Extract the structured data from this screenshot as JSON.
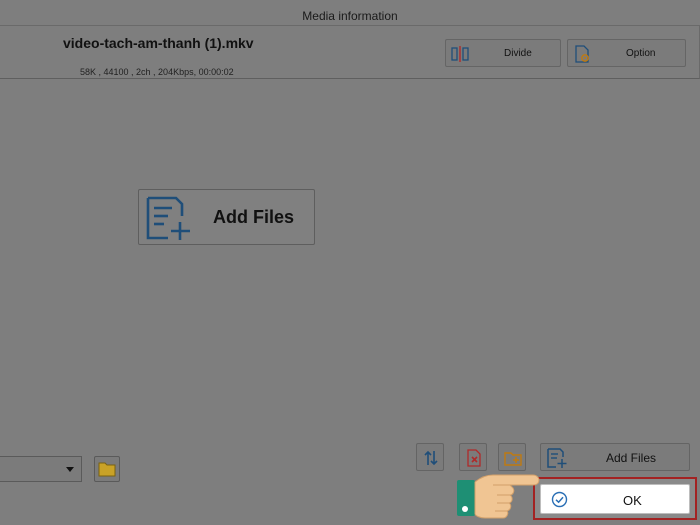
{
  "header": {
    "title": "Media information"
  },
  "media": {
    "file_name": "video-tach-am-thanh (1).mkv",
    "meta": "58K , 44100 , 2ch , 204Kbps, 00:00:02"
  },
  "toolbar": {
    "divide_label": "Divide",
    "option_label": "Option"
  },
  "center": {
    "add_files_label": "Add Files"
  },
  "bottom": {
    "add_files_label": "Add Files",
    "ok_label": "OK"
  },
  "colors": {
    "icon_blue": "#1f4e79",
    "icon_red": "#b02a2a",
    "icon_orange": "#c07a10",
    "folder_yellow": "#c9a227",
    "highlight": "#a32222",
    "cuff_teal": "#1e8f74",
    "skin": "#f0c593"
  },
  "icons": [
    "divide-icon",
    "option-icon",
    "add-files-icon",
    "sort-icon",
    "remove-file-icon",
    "add-folder-icon",
    "folder-icon",
    "check-circle-icon",
    "pointing-hand-icon"
  ]
}
